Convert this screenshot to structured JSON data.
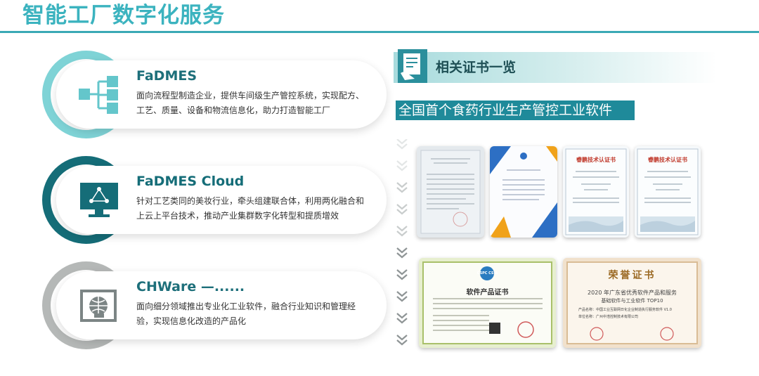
{
  "page": {
    "title": "智能工厂数字化服务"
  },
  "services": [
    {
      "name": "FaDMES",
      "icon": "hierarchy-network-icon",
      "description": "面向流程型制造企业，提供车间级生产管控系统，实现配方、工艺、质量、设备和物流信息化，助力打造智能工厂",
      "accent": "#7fd3d6"
    },
    {
      "name": "FaDMES Cloud",
      "icon": "cloud-monitor-icon",
      "description": "针对工艺类同的美妆行业，牵头组建联合体，利用两化融合和上云上平台技术，推动产业集群数字化转型和提质增效",
      "accent": "#156d78"
    },
    {
      "name": "CHWare —......",
      "icon": "globe-window-icon",
      "description": "面向细分领域推出专业化工业软件，融合行业知识和管理经验，实现信息化改造的产品化",
      "accent": "#b5b8b7"
    }
  ],
  "certificates": {
    "banner": "相关证书一览",
    "subtitle": "全国首个食药行业生产管控工业软件",
    "items": [
      {
        "type": "software-copyright"
      },
      {
        "type": "blue-certificate"
      },
      {
        "type": "ruipeng",
        "title": "睿鹏技术认证书"
      },
      {
        "type": "ruipeng",
        "title": "睿鹏技术认证书"
      },
      {
        "type": "software-product",
        "title": "软件产品证书",
        "logo": "CSPC CSIA"
      },
      {
        "type": "honor",
        "title": "荣誉证书",
        "line1": "2020 年广东省优秀软件产品和服务",
        "line2": "基础软件与工业软件 TOP10",
        "line3": "产品名称：中国工业互联网日化企业制造执行服务软件 V1.0",
        "line4": "单位名称：广州中浩控制技术有限公司"
      }
    ]
  }
}
